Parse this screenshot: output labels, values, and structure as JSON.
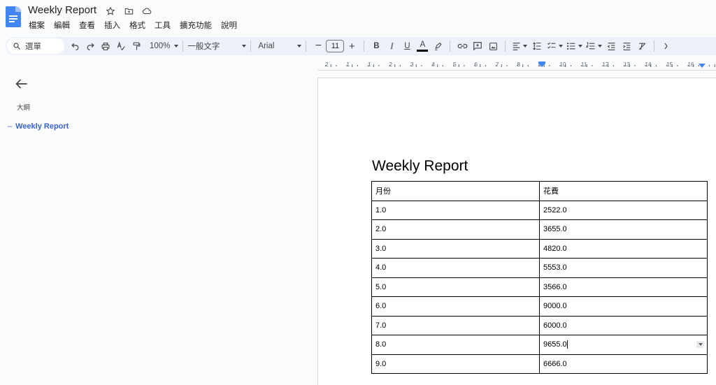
{
  "document": {
    "title": "Weekly Report"
  },
  "menu": [
    "檔案",
    "編輯",
    "查看",
    "插入",
    "格式",
    "工具",
    "擴充功能",
    "說明"
  ],
  "toolbar": {
    "search_label": "選單",
    "zoom": "100%",
    "style": "一般文字",
    "font": "Arial",
    "font_size": "11"
  },
  "ruler": {
    "numbers": [
      "2",
      "1",
      "1",
      "2",
      "3",
      "4",
      "5",
      "6",
      "7",
      "8",
      "9",
      "10",
      "11",
      "12",
      "13",
      "14",
      "15",
      "16"
    ]
  },
  "outline": {
    "label": "大綱",
    "items": [
      {
        "label": "Weekly Report"
      }
    ]
  },
  "page": {
    "heading": "Weekly Report",
    "table": {
      "headers": [
        "月份",
        "花費"
      ],
      "rows": [
        [
          "1.0",
          "2522.0"
        ],
        [
          "2.0",
          "3655.0"
        ],
        [
          "3.0",
          "4820.0"
        ],
        [
          "4.0",
          "5553.0"
        ],
        [
          "5.0",
          "3566.0"
        ],
        [
          "6.0",
          "9000.0"
        ],
        [
          "7.0",
          "6000.0"
        ],
        [
          "8.0",
          "9655.0"
        ],
        [
          "9.0",
          "6666.0"
        ]
      ]
    }
  },
  "colors": {
    "accent": "#3c64c8",
    "toolbar_bg": "#edf2fa",
    "doc_icon": "#4285f4"
  }
}
